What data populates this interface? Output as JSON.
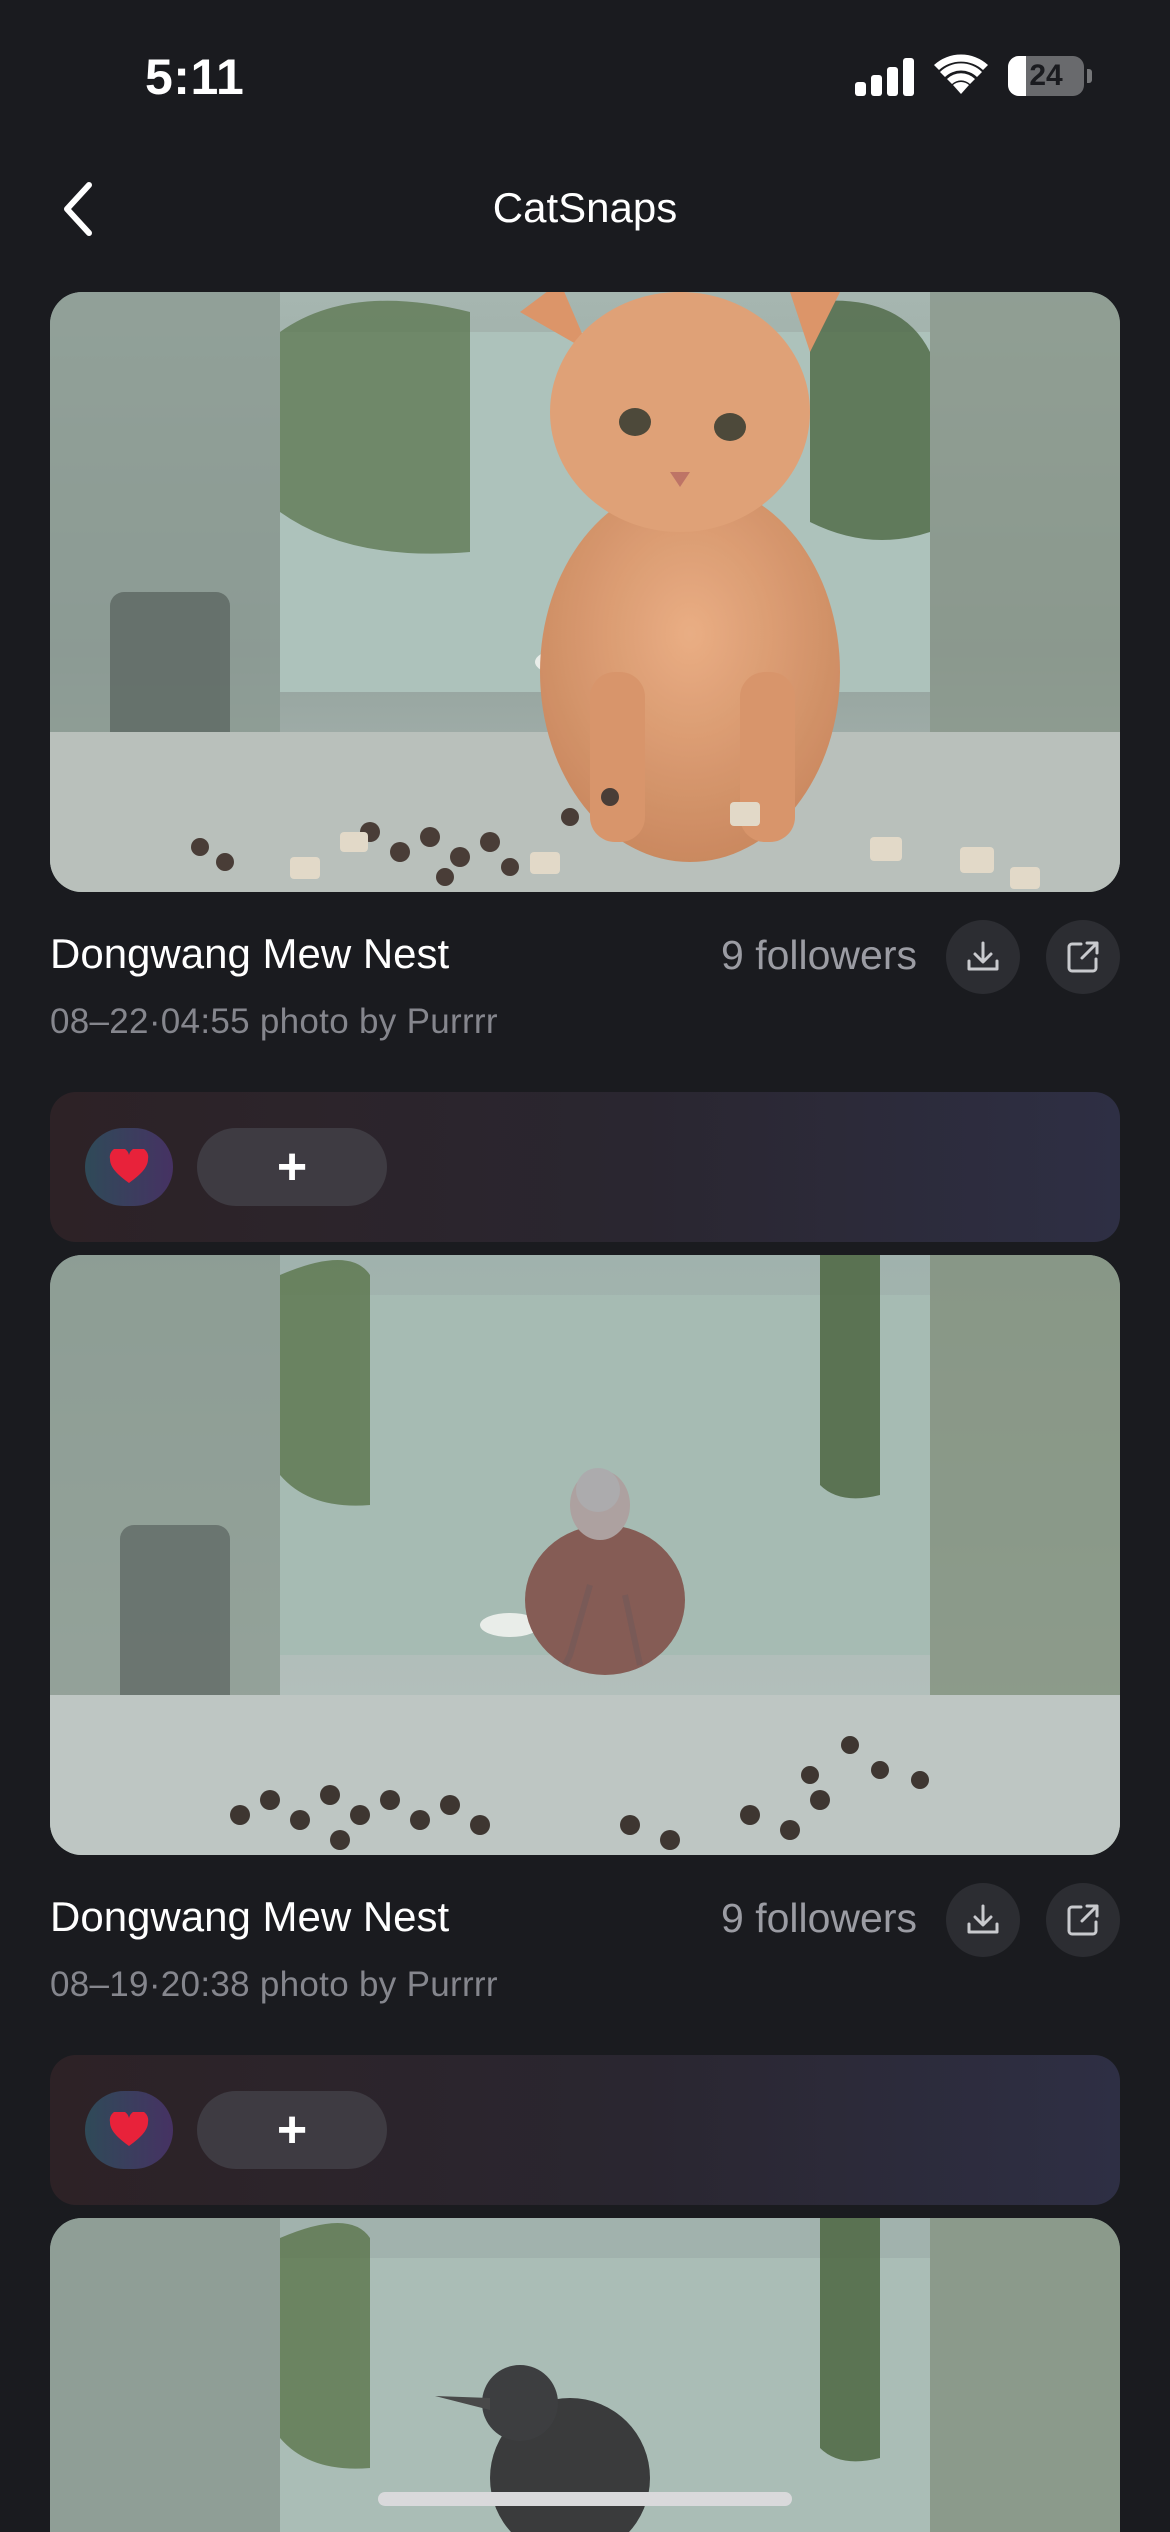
{
  "status_bar": {
    "time": "5:11",
    "battery": "24",
    "battery_percent": 24
  },
  "nav": {
    "title": "CatSnaps",
    "back_icon": "chevron-left-icon"
  },
  "posts": [
    {
      "location": "Dongwang Mew Nest",
      "followers": "9 followers",
      "meta": "08–22·04:55 photo by Purrrr",
      "photo_subject": "orange cat",
      "reaction": "❤️",
      "add_label": "+"
    },
    {
      "location": "Dongwang Mew Nest",
      "followers": "9 followers",
      "meta": "08–19·20:38 photo by Purrrr",
      "photo_subject": "spotted dove",
      "reaction": "❤️",
      "add_label": "+"
    },
    {
      "photo_subject": "black bird"
    }
  ],
  "colors": {
    "background": "#1a1b1f",
    "secondary_text": "#9b9ca3",
    "heart": "#e8223a"
  }
}
